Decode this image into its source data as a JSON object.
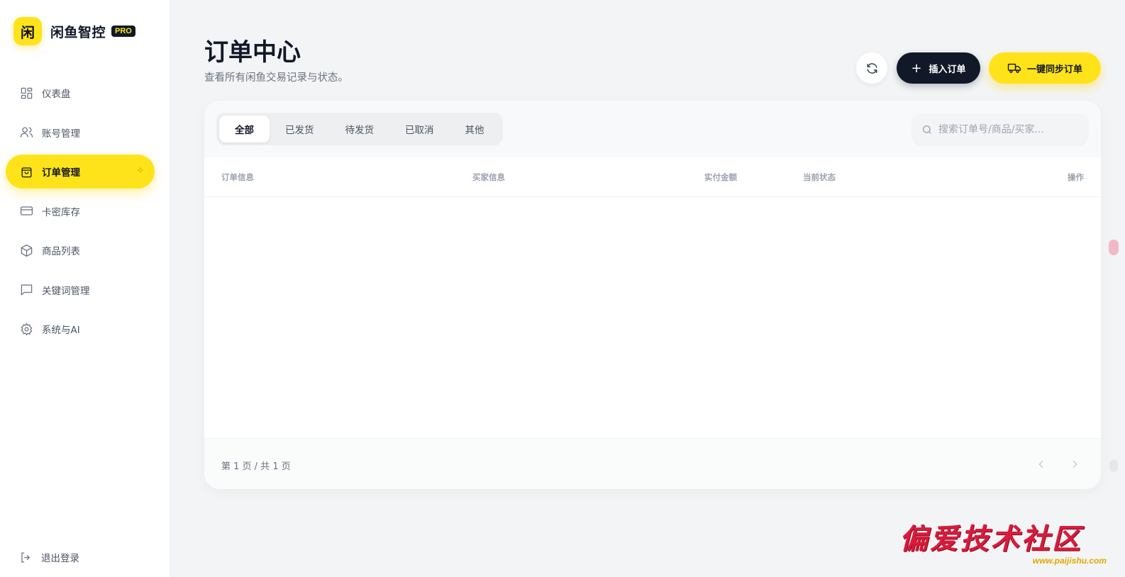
{
  "brand": {
    "logo_char": "闲",
    "name": "闲鱼智控",
    "badge": "PRO"
  },
  "sidebar": {
    "items": [
      {
        "label": "仪表盘",
        "icon": "dashboard-icon",
        "active": false
      },
      {
        "label": "账号管理",
        "icon": "users-icon",
        "active": false
      },
      {
        "label": "订单管理",
        "icon": "shopping-bag-icon",
        "active": true
      },
      {
        "label": "卡密库存",
        "icon": "credit-card-icon",
        "active": false
      },
      {
        "label": "商品列表",
        "icon": "box-icon",
        "active": false
      },
      {
        "label": "关键词管理",
        "icon": "chat-icon",
        "active": false
      },
      {
        "label": "系统与AI",
        "icon": "gear-icon",
        "active": false
      }
    ],
    "logout_label": "退出登录"
  },
  "header": {
    "title": "订单中心",
    "subtitle": "查看所有闲鱼交易记录与状态。",
    "insert_label": "插入订单",
    "sync_label": "一键同步订单"
  },
  "tabs": [
    "全部",
    "已发货",
    "待发货",
    "已取消",
    "其他"
  ],
  "active_tab": "全部",
  "search": {
    "placeholder": "搜索订单号/商品/买家..."
  },
  "table": {
    "columns": [
      "订单信息",
      "买家信息",
      "实付金额",
      "当前状态",
      "操作"
    ],
    "rows": []
  },
  "pagination": {
    "text": "第 1 页 / 共 1 页",
    "current": 1,
    "total": 1
  },
  "watermark": {
    "text": "偏爱技术社区",
    "url": "www.paijishu.com"
  },
  "colors": {
    "accent": "#ffe31a",
    "dark": "#111827",
    "background": "#f3f4f6"
  }
}
